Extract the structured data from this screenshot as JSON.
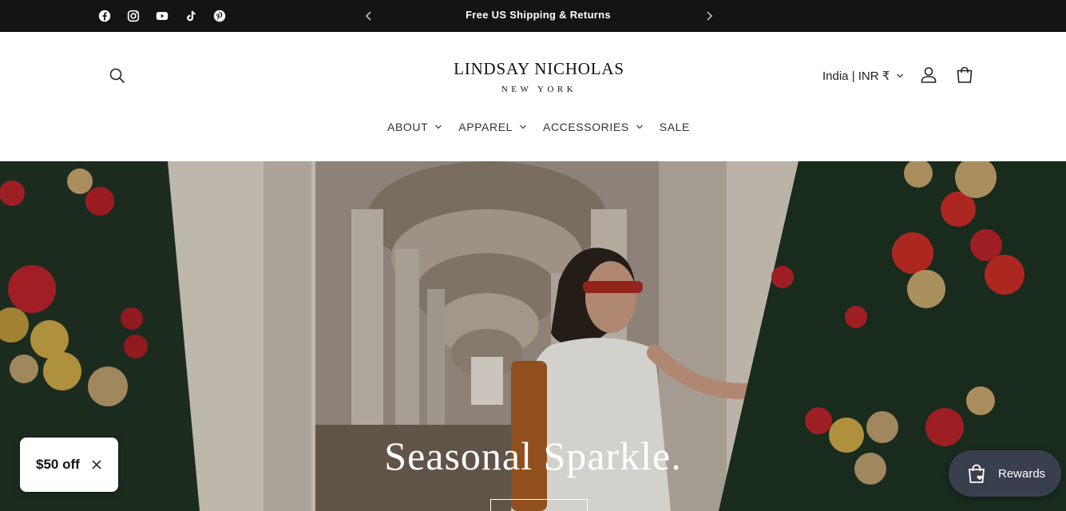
{
  "announcement": {
    "text": "Free US Shipping & Returns",
    "social_icons": [
      "facebook-icon",
      "instagram-icon",
      "youtube-icon",
      "tiktok-icon",
      "pinterest-icon"
    ]
  },
  "header": {
    "logo_main": "LINDSAY NICHOLAS",
    "logo_sub": "NEW YORK",
    "locale": "India | INR ₹",
    "nav": [
      {
        "label": "ABOUT",
        "has_dropdown": true
      },
      {
        "label": "APPAREL",
        "has_dropdown": true
      },
      {
        "label": "ACCESSORIES",
        "has_dropdown": true
      },
      {
        "label": "SALE",
        "has_dropdown": false
      }
    ]
  },
  "hero": {
    "title": "Seasonal Sparkle."
  },
  "discount_widget": {
    "label": "$50 off"
  },
  "rewards_widget": {
    "label": "Rewards"
  },
  "colors": {
    "announcement_bg": "#141414",
    "rewards_bg": "#3a3f4e",
    "header_bg": "#ffffff"
  }
}
